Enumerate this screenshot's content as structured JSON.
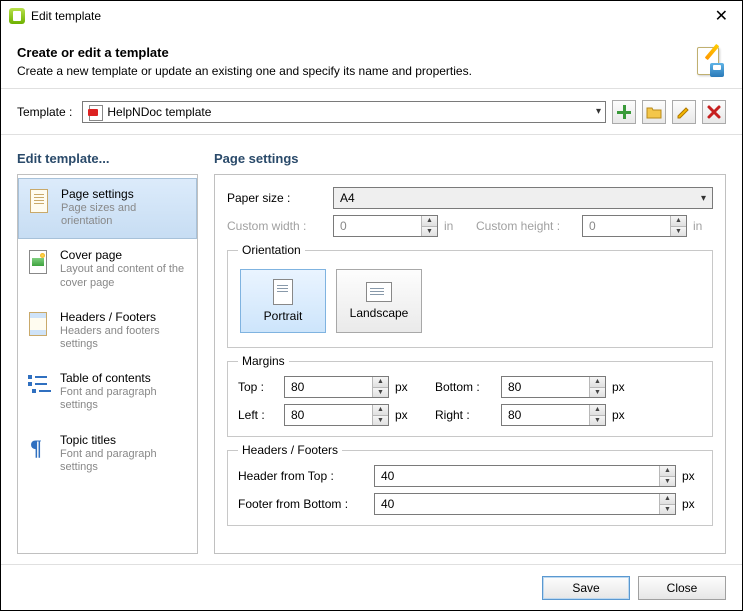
{
  "window": {
    "title": "Edit template"
  },
  "header": {
    "title": "Create or edit a template",
    "subtitle": "Create a new template or update an existing one and specify its name and properties."
  },
  "templateRow": {
    "label": "Template :",
    "value": "HelpNDoc template"
  },
  "sidebar": {
    "heading": "Edit template...",
    "items": [
      {
        "title": "Page settings",
        "desc": "Page sizes and orientation"
      },
      {
        "title": "Cover page",
        "desc": "Layout and content of the cover page"
      },
      {
        "title": "Headers / Footers",
        "desc": "Headers and footers settings"
      },
      {
        "title": "Table of contents",
        "desc": "Font and paragraph settings"
      },
      {
        "title": "Topic titles",
        "desc": "Font and paragraph settings"
      }
    ]
  },
  "main": {
    "heading": "Page settings",
    "paperSize": {
      "label": "Paper size :",
      "value": "A4"
    },
    "customWidth": {
      "label": "Custom width :",
      "value": "0",
      "unit": "in"
    },
    "customHeight": {
      "label": "Custom height :",
      "value": "0",
      "unit": "in"
    },
    "orientation": {
      "legend": "Orientation",
      "portrait": "Portrait",
      "landscape": "Landscape"
    },
    "margins": {
      "legend": "Margins",
      "top": {
        "label": "Top :",
        "value": "80",
        "unit": "px"
      },
      "bottom": {
        "label": "Bottom :",
        "value": "80",
        "unit": "px"
      },
      "left": {
        "label": "Left :",
        "value": "80",
        "unit": "px"
      },
      "right": {
        "label": "Right :",
        "value": "80",
        "unit": "px"
      }
    },
    "hf": {
      "legend": "Headers / Footers",
      "headerTop": {
        "label": "Header from Top :",
        "value": "40",
        "unit": "px"
      },
      "footerBottom": {
        "label": "Footer from Bottom :",
        "value": "40",
        "unit": "px"
      }
    }
  },
  "footer": {
    "save": "Save",
    "close": "Close"
  }
}
